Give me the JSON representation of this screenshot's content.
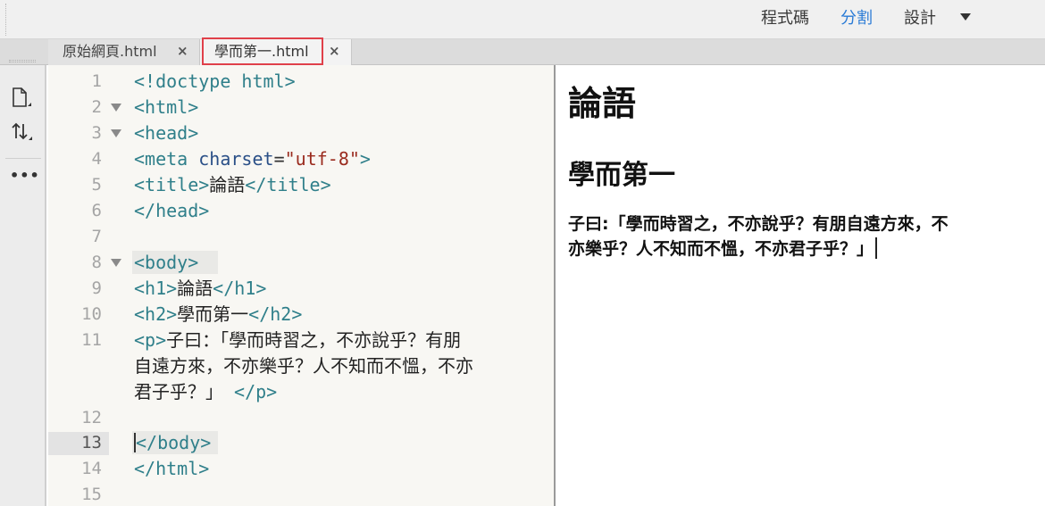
{
  "toolbar": {
    "views": [
      {
        "label": "程式碼",
        "active": false
      },
      {
        "label": "分割",
        "active": true
      },
      {
        "label": "設計",
        "active": false
      }
    ],
    "dropdown_icon": "triangle-down-icon",
    "active_color": "#2a7bd6"
  },
  "tabs": [
    {
      "label": "原始網頁.html",
      "close": "×",
      "active": false
    },
    {
      "label": "學而第一.html",
      "close": "×",
      "active": true
    }
  ],
  "sidebar": {
    "icons": [
      "new-file-icon",
      "sort-arrows-icon",
      "more-options-icon"
    ],
    "more_label": "•••"
  },
  "editor": {
    "active_line": 13,
    "lines": [
      {
        "n": "1"
      },
      {
        "n": "2"
      },
      {
        "n": "3"
      },
      {
        "n": "4"
      },
      {
        "n": "5"
      },
      {
        "n": "6"
      },
      {
        "n": "7"
      },
      {
        "n": "8"
      },
      {
        "n": "9"
      },
      {
        "n": "10"
      },
      {
        "n": "11"
      },
      {
        "n": "12"
      },
      {
        "n": "13"
      },
      {
        "n": "14"
      },
      {
        "n": "15"
      }
    ],
    "code": {
      "l1": "<!doctype html>",
      "l2": "<html>",
      "l3": "<head>",
      "l4_tag_open": "<meta",
      "l4_attr": "charset",
      "l4_eq": "=",
      "l4_val": "\"utf-8\"",
      "l4_tag_close": ">",
      "l5_open": "<title>",
      "l5_text": "論語",
      "l5_close": "</title>",
      "l6": "</head>",
      "l8": "<body>",
      "l9_open": "<h1>",
      "l9_text": "論語",
      "l9_close": "</h1>",
      "l10_open": "<h2>",
      "l10_text": "學而第一",
      "l10_close": "</h2>",
      "l11_open": "<p>",
      "l11_text_a": "子曰：「學而時習之，不亦說乎？有朋",
      "l11_text_b": "自遠方來，不亦樂乎？人不知而不慍，不亦",
      "l11_text_c": "君子乎？」",
      "l11_close": "</p>",
      "l13": "</body>",
      "l14": "</html>"
    }
  },
  "preview": {
    "h1": "論語",
    "h2": "學而第一",
    "p_line1": "子曰:「學而時習之，不亦說乎？有朋自遠方來，不",
    "p_line2": "亦樂乎？人不知而不慍，不亦君子乎？」"
  },
  "colors": {
    "tag": "#2f7f8a",
    "attr": "#2a4f87",
    "string": "#9a2b1e",
    "tab_highlight": "#e0404a"
  }
}
